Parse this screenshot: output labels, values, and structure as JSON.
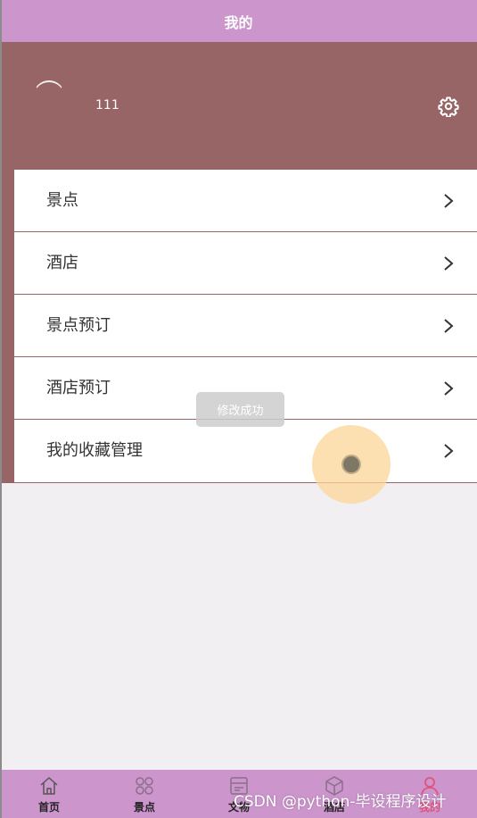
{
  "header": {
    "title": "我的"
  },
  "profile": {
    "username": "111",
    "settings_icon": "gear-icon"
  },
  "menu": {
    "items": [
      {
        "label": "景点"
      },
      {
        "label": "酒店"
      },
      {
        "label": "景点预订"
      },
      {
        "label": "酒店预订"
      },
      {
        "label": "我的收藏管理"
      }
    ],
    "chevron_icon": "chevron-right-icon"
  },
  "toast": {
    "message": "修改成功"
  },
  "tabbar": {
    "tabs": [
      {
        "label": "首页",
        "icon": "home-icon"
      },
      {
        "label": "景点",
        "icon": "grid-icon"
      },
      {
        "label": "文物",
        "icon": "artifact-icon"
      },
      {
        "label": "酒店",
        "icon": "hotel-icon"
      },
      {
        "label": "我的",
        "icon": "user-icon",
        "active": true
      }
    ]
  },
  "watermark": {
    "text": "CSDN @python-毕设程序设计"
  },
  "colors": {
    "top_bar": "#cc95cc",
    "header_band": "#976566",
    "page_bg": "#f1eff2",
    "active_tab": "#e0547a"
  }
}
